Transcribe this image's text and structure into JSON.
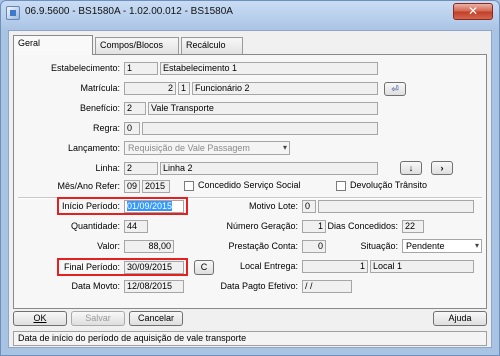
{
  "window": {
    "title": "06.9.5600 - BS1580A - 1.02.00.012 - BS1580A",
    "close_glyph": "✕"
  },
  "tabs": [
    {
      "label": "Geral",
      "active": true
    },
    {
      "label": "Compos/Blocos",
      "active": false
    },
    {
      "label": "Recálculo",
      "active": false
    }
  ],
  "form": {
    "estabelecimento": {
      "label": "Estabelecimento:",
      "code": "1",
      "name": "Estabelecimento 1"
    },
    "matricula": {
      "label": "Matrícula:",
      "number": "2",
      "digit": "1",
      "name": "Funcionário 2"
    },
    "beneficio": {
      "label": "Benefício:",
      "code": "2",
      "name": "Vale Transporte"
    },
    "regra": {
      "label": "Regra:",
      "code": "0"
    },
    "lancamento": {
      "label": "Lançamento:",
      "value": "Requisição de Vale Passagem"
    },
    "linha": {
      "label": "Linha:",
      "code": "2",
      "name": "Linha 2"
    },
    "mes_ano_refer": {
      "label": "Mês/Ano Refer:",
      "month": "09",
      "year": "2015"
    },
    "concedido_servico_social": {
      "label": "Concedido Serviço Social",
      "checked": false
    },
    "devolucao_transito": {
      "label": "Devolução Trânsito",
      "checked": false
    },
    "inicio_periodo": {
      "label": "Início Período:",
      "value": "01/09/2015"
    },
    "motivo_lote": {
      "label": "Motivo Lote:",
      "value": "0"
    },
    "quantidade": {
      "label": "Quantidade:",
      "value": "44"
    },
    "numero_geracao": {
      "label": "Número Geração:",
      "value": "1"
    },
    "dias_concedidos": {
      "label": "Dias Concedidos:",
      "value": "22"
    },
    "valor": {
      "label": "Valor:",
      "value": "88,00"
    },
    "prestacao_contas": {
      "label": "Prestação Conta:",
      "value": "0"
    },
    "situacao": {
      "label": "Situação:",
      "value": "Pendente"
    },
    "final_periodo": {
      "label": "Final Período:",
      "value": "30/09/2015",
      "button": "C"
    },
    "local_entrega": {
      "label": "Local Entrega:",
      "code": "1",
      "name": "Local 1"
    },
    "data_movto": {
      "label": "Data Movto:",
      "value": "12/08/2015"
    },
    "data_pagto_efetivo": {
      "label": "Data Pagto Efetivo:",
      "value": " / /"
    }
  },
  "buttons": {
    "ok": "OK",
    "salvar": "Salvar",
    "cancelar": "Cancelar",
    "ajuda": "Ajuda"
  },
  "status_text": "Data de início do período de aquisição de vale transporte",
  "icons": {
    "enter": "⏎",
    "down": "↓",
    "next": "›",
    "dropdown": "▾"
  },
  "colors": {
    "highlight_box": "#e42020",
    "selection": "#3399ff"
  }
}
